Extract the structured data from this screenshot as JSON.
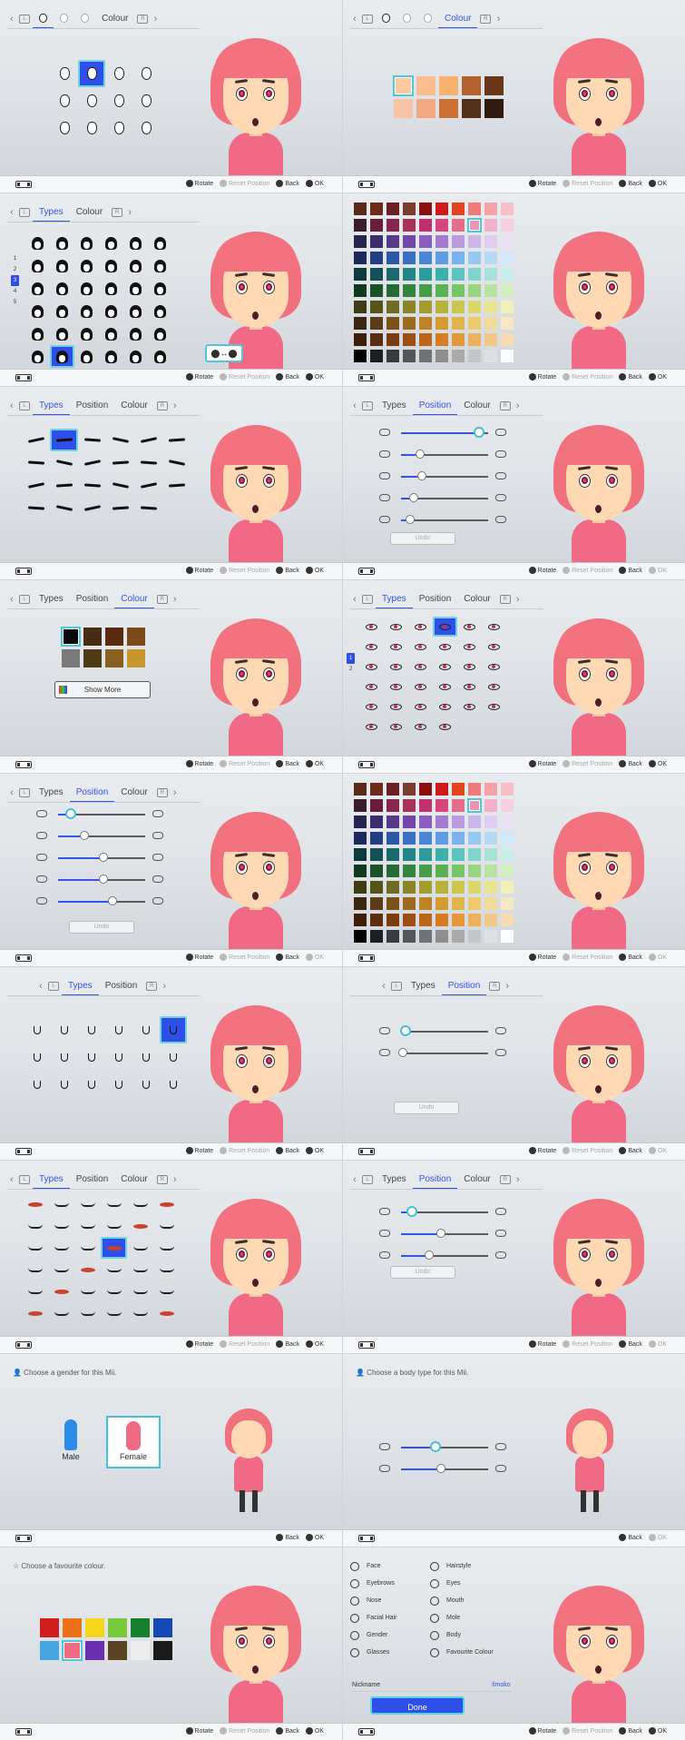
{
  "controls": {
    "rotate": "Rotate",
    "reset": "Reset Position",
    "back": "Back",
    "ok": "OK"
  },
  "tabs": {
    "colour": "Colour",
    "types": "Types",
    "position": "Position"
  },
  "panel_colour_skin": [
    "#fbcaa0",
    "#fbbd8e",
    "#f7b26e",
    "#b3612e",
    "#6a361a",
    "#f7c3a4",
    "#f3a882",
    "#cc7036",
    "#53301c",
    "#2f1b10"
  ],
  "hair_palette": [
    [
      "#5a2a18",
      "#6f2b1a",
      "#6b1e24",
      "#7a3c2c",
      "#8a1010",
      "#d01a1a",
      "#e2451d",
      "#f07b7b",
      "#f6a1a6",
      "#f7c0c6"
    ],
    [
      "#3a1f2a",
      "#6a1d3a",
      "#8c2450",
      "#a8325c",
      "#c0306c",
      "#d4487c",
      "#e36d8a",
      "#ea95b7",
      "#f2b0cc",
      "#f6cfe0"
    ],
    [
      "#2a2450",
      "#3c2c6e",
      "#563b88",
      "#7046a8",
      "#8a5ec0",
      "#a37ad0",
      "#bb9ade",
      "#cfb6e8",
      "#e0cdf0",
      "#ede1f6"
    ],
    [
      "#1b2a5a",
      "#223e80",
      "#2c56a6",
      "#3a6fc6",
      "#4a86d8",
      "#5f9ce4",
      "#7ab2ec",
      "#98c7f2",
      "#b6d9f6",
      "#d2e8fa"
    ],
    [
      "#0e3a3e",
      "#145055",
      "#1a6a6c",
      "#228585",
      "#2c9c9a",
      "#3cb0ac",
      "#5cc4bc",
      "#80d4cc",
      "#a6e2da",
      "#c8eee8"
    ],
    [
      "#123a1e",
      "#1b5228",
      "#266b33",
      "#33843f",
      "#469c4a",
      "#5cb154",
      "#78c468",
      "#98d482",
      "#b8e2a0",
      "#d4eec0"
    ],
    [
      "#3e3c12",
      "#56541a",
      "#6e6c22",
      "#888528",
      "#a09c2e",
      "#b7b23a",
      "#cac64e",
      "#dad86a",
      "#e6e690",
      "#f0f0b8"
    ],
    [
      "#3c2812",
      "#5a3c16",
      "#7a521a",
      "#9c6a1e",
      "#bc8424",
      "#d49c30",
      "#e2b44c",
      "#ecc86e",
      "#f2da98",
      "#f6e8c2"
    ],
    [
      "#3e1e0a",
      "#5c2c0e",
      "#7a3c10",
      "#9c4e14",
      "#bc6418",
      "#d67c22",
      "#e4963c",
      "#ecb05e",
      "#f2c888",
      "#f6dcb2"
    ],
    [
      "#000000",
      "#1e1e1e",
      "#3a3a3a",
      "#565656",
      "#727272",
      "#8e8e8e",
      "#aaaaaa",
      "#c6c6c6",
      "#e0e0e0",
      "#ffffff"
    ]
  ],
  "eye_colours": [
    "#0a0a0a",
    "#4a2c14",
    "#5a2a10",
    "#7a4a1a",
    "#7a7a7a",
    "#4e3a14",
    "#8a6020",
    "#c8962e"
  ],
  "show_more": "Show More",
  "gender_prompt": "Choose a gender for this Mii.",
  "body_prompt": "Choose a body type for this Mii.",
  "male": "Male",
  "female": "Female",
  "colour_prompt": "Choose a favourite colour.",
  "fav_colours": [
    "#d01d1d",
    "#ef7216",
    "#f6d51a",
    "#79c93a",
    "#17802e",
    "#1448b3",
    "#47a6e0",
    "#f16a85",
    "#6a2eb0",
    "#5a4424",
    "#ececec",
    "#1a1a1a"
  ],
  "menu": [
    {
      "label": "Face",
      "icon": "face-icon"
    },
    {
      "label": "Hairstyle",
      "icon": "hairstyle-icon"
    },
    {
      "label": "Eyebrows",
      "icon": "eyebrows-icon"
    },
    {
      "label": "Eyes",
      "icon": "eyes-icon"
    },
    {
      "label": "Nose",
      "icon": "nose-icon"
    },
    {
      "label": "Mouth",
      "icon": "mouth-icon"
    },
    {
      "label": "Facial Hair",
      "icon": "facial-hair-icon"
    },
    {
      "label": "Mole",
      "icon": "mole-icon"
    },
    {
      "label": "Gender",
      "icon": "gender-icon"
    },
    {
      "label": "Body",
      "icon": "body-icon"
    },
    {
      "label": "Glasses",
      "icon": "glasses-icon"
    },
    {
      "label": "Favourite Colour",
      "icon": "favourite-colour-icon"
    }
  ],
  "nickname_label": "Nickname",
  "nickname_value": "Ilmoko",
  "done": "Done",
  "undo": "Undo",
  "row_numbers": [
    "1",
    "2",
    "3",
    "4",
    "5"
  ],
  "eye_row_numbers": [
    "1",
    "2"
  ]
}
